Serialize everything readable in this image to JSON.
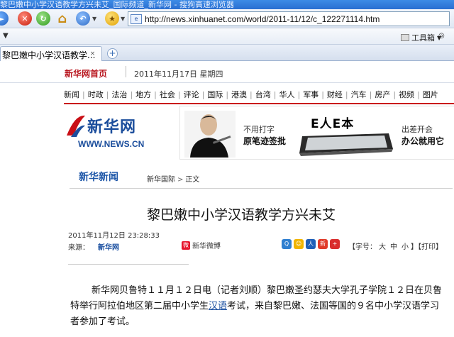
{
  "window": {
    "title": "黎巴嫩中小学汉语教学方兴未艾_国际频道_新华网 - 搜狗高速浏览器"
  },
  "navbar": {
    "url": "http://news.xinhuanet.com/world/2011-11/12/c_122271114.htm"
  },
  "toolbar": {
    "tools_label": "工具箱"
  },
  "tab": {
    "title": "黎巴嫩中小学汉语教学...",
    "close_glyph": "×",
    "new_tab_glyph": "+"
  },
  "homebar": {
    "home_link": "新华网首页",
    "date": "2011年11月17日  星期四"
  },
  "channels": [
    "新闻",
    "时政",
    "法治",
    "地方",
    "社会",
    "评论",
    "国际",
    "港澳",
    "台湾",
    "华人",
    "军事",
    "财经",
    "汽车",
    "房产",
    "视频",
    "图片"
  ],
  "logo": {
    "name_cn": "新华网",
    "name_en": "WWW.NEWS.CN"
  },
  "banner": {
    "line1": "不用打字",
    "line2": "原笔迹签批",
    "brand": "E人E本",
    "line3": "出差开会",
    "line4": "办公就用它"
  },
  "section": {
    "title": "新华新闻",
    "crumb_channel": "新华国际",
    "crumb_arrow": ">",
    "crumb_current": "正文"
  },
  "article": {
    "headline": "黎巴嫩中小学汉语教学方兴未艾",
    "datetime": "2011年11月12日  23:28:33",
    "source_label": "来源：",
    "source_name": "新华网",
    "weibo_label": "新华微博",
    "font_label_open": "【字号：",
    "font_large": "大",
    "font_medium": "中",
    "font_small": "小",
    "font_label_close": "】",
    "print_label": "【打印】",
    "body_before_link": "新华网贝鲁特１１月１２日电（记者刘顺）黎巴嫩圣约瑟夫大学孔子学院１２日在贝鲁特举行阿拉伯地区第二届中小学生",
    "body_link": "汉语",
    "body_after_link": "考试，来自黎巴嫩、法国等国的９名中小学汉语学习者参加了考试。"
  },
  "colors": {
    "brand_red": "#c90f16",
    "brand_blue": "#1c4e9c",
    "link_blue": "#1a4fa0"
  }
}
